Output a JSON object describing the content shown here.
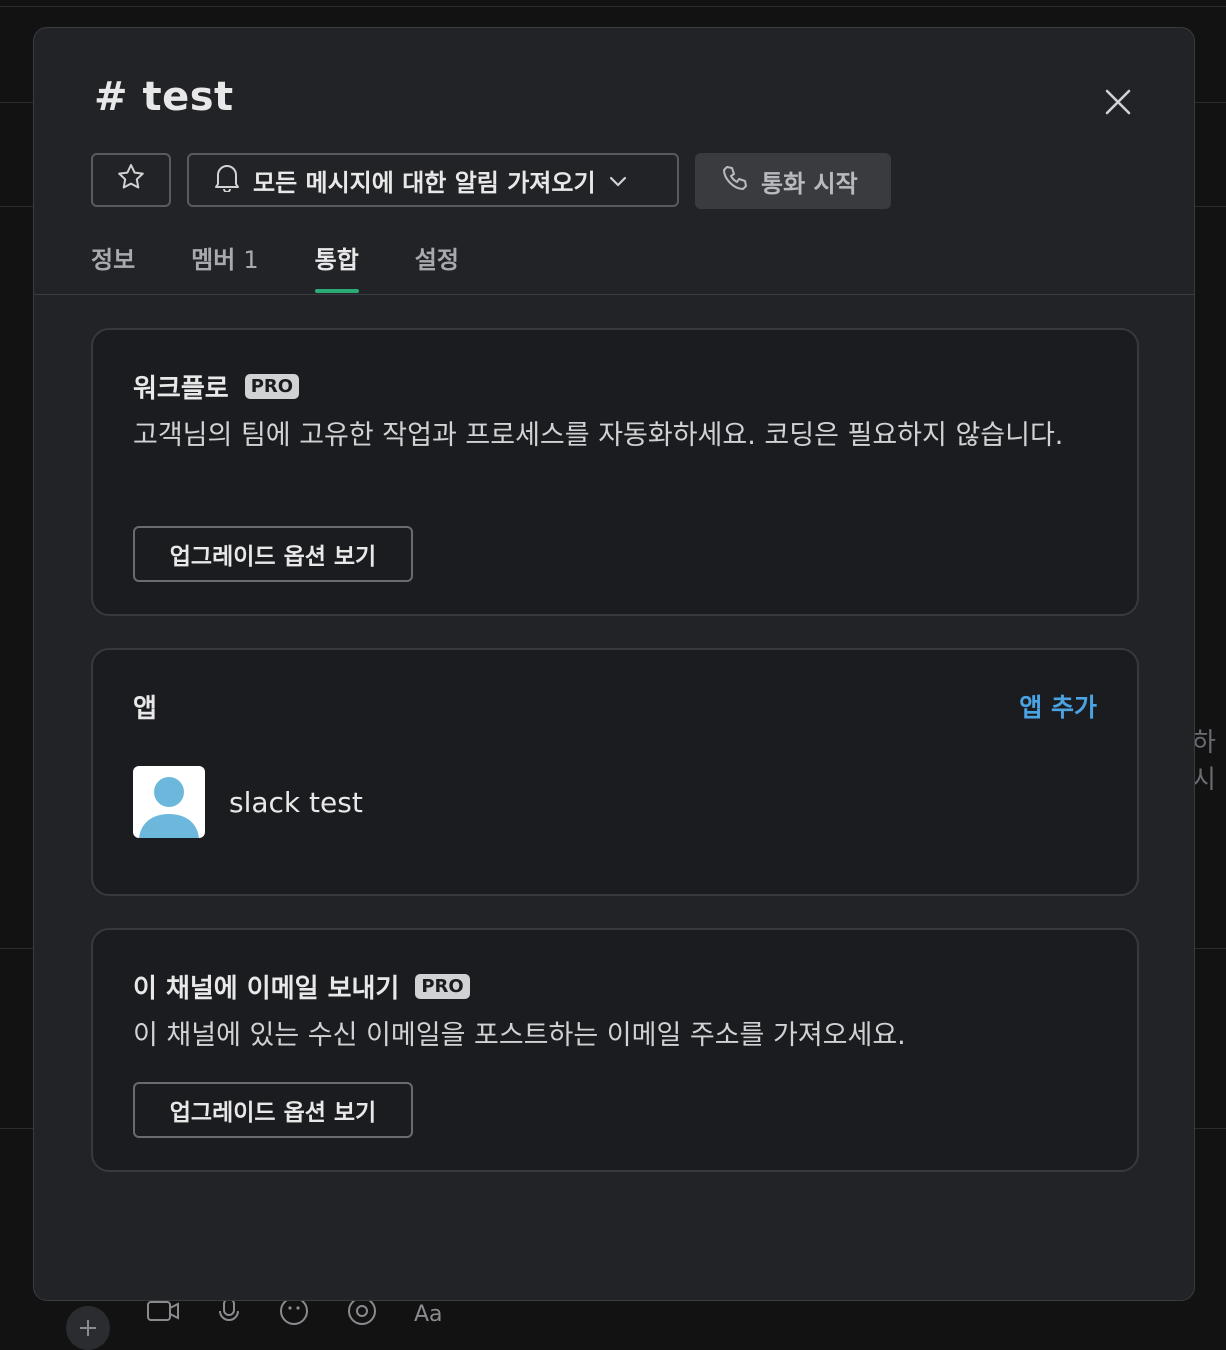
{
  "background": {
    "peek_text": "하시",
    "composer_icons": [
      "plus-icon",
      "video-icon",
      "microphone-icon",
      "emoji-icon",
      "mention-icon",
      "format-text-icon"
    ],
    "composer_format_label": "Aa"
  },
  "channel": {
    "title": "# test"
  },
  "actions": {
    "notify_label": "모든 메시지에 대한 알림 가져오기",
    "call_label": "통화 시작"
  },
  "tabs": [
    {
      "label": "정보",
      "count": ""
    },
    {
      "label": "멤버",
      "count": "1"
    },
    {
      "label": "통합",
      "count": ""
    },
    {
      "label": "설정",
      "count": ""
    }
  ],
  "active_tab": "통합",
  "workflow_card": {
    "title": "워크플로",
    "badge": "PRO",
    "description": "고객님의 팀에 고유한 작업과 프로세스를 자동화하세요. 코딩은 필요하지 않습니다.",
    "button_label": "업그레이드 옵션 보기"
  },
  "apps_card": {
    "title": "앱",
    "add_label": "앱 추가",
    "apps": [
      {
        "name": "slack test"
      }
    ]
  },
  "email_card": {
    "title": "이 채널에 이메일 보내기",
    "badge": "PRO",
    "description": "이 채널에 있는 수신 이메일을 포스트하는 이메일 주소를 가져오세요.",
    "button_label": "업그레이드 옵션 보기"
  },
  "colors": {
    "accent_green": "#2bac76",
    "link_blue": "#4ba3e3",
    "modal_bg": "#222326",
    "card_bg": "#1b1c1f"
  }
}
